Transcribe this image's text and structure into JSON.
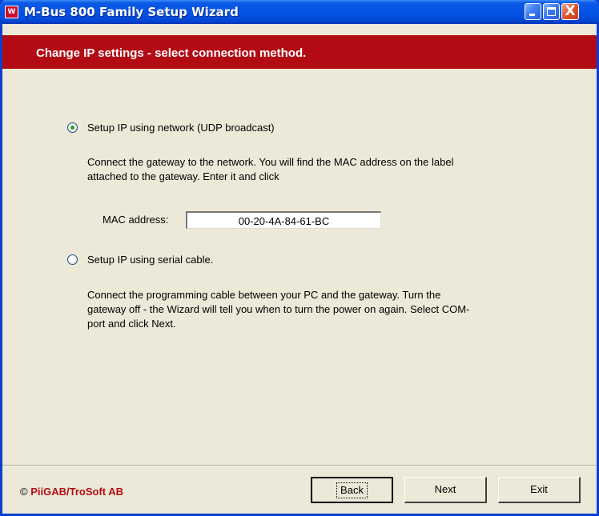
{
  "window": {
    "title": "M-Bus 800 Family Setup Wizard",
    "app_icon_letter": "W",
    "close_glyph": "X"
  },
  "header": {
    "text": "Change IP settings - select connection method."
  },
  "options": {
    "network": {
      "label": "Setup IP using network (UDP broadcast)",
      "selected": true,
      "description": "Connect the gateway to the network. You will find the MAC address on the label attached to the gateway. Enter it and click"
    },
    "serial": {
      "label": "Setup IP using serial cable.",
      "selected": false,
      "description": "Connect the programming cable between your PC and the gateway. Turn the gateway off - the Wizard will tell you when to turn the power on again. Select COM-port and click Next."
    }
  },
  "mac": {
    "label": "MAC address:",
    "value": "00-20-4A-84-61-BC"
  },
  "footer": {
    "copyright_symbol": "©",
    "company": "PiiGAB/TroSoft AB",
    "back_label": "Back",
    "next_label": "Next",
    "exit_label": "Exit"
  },
  "icons": [
    "app-w-icon",
    "minimize-icon",
    "maximize-icon",
    "close-icon"
  ],
  "colors": {
    "title_bar": "#0553e4",
    "header_band": "#b30b14",
    "client_bg": "#ece9d8",
    "brand_text": "#b30b14"
  }
}
